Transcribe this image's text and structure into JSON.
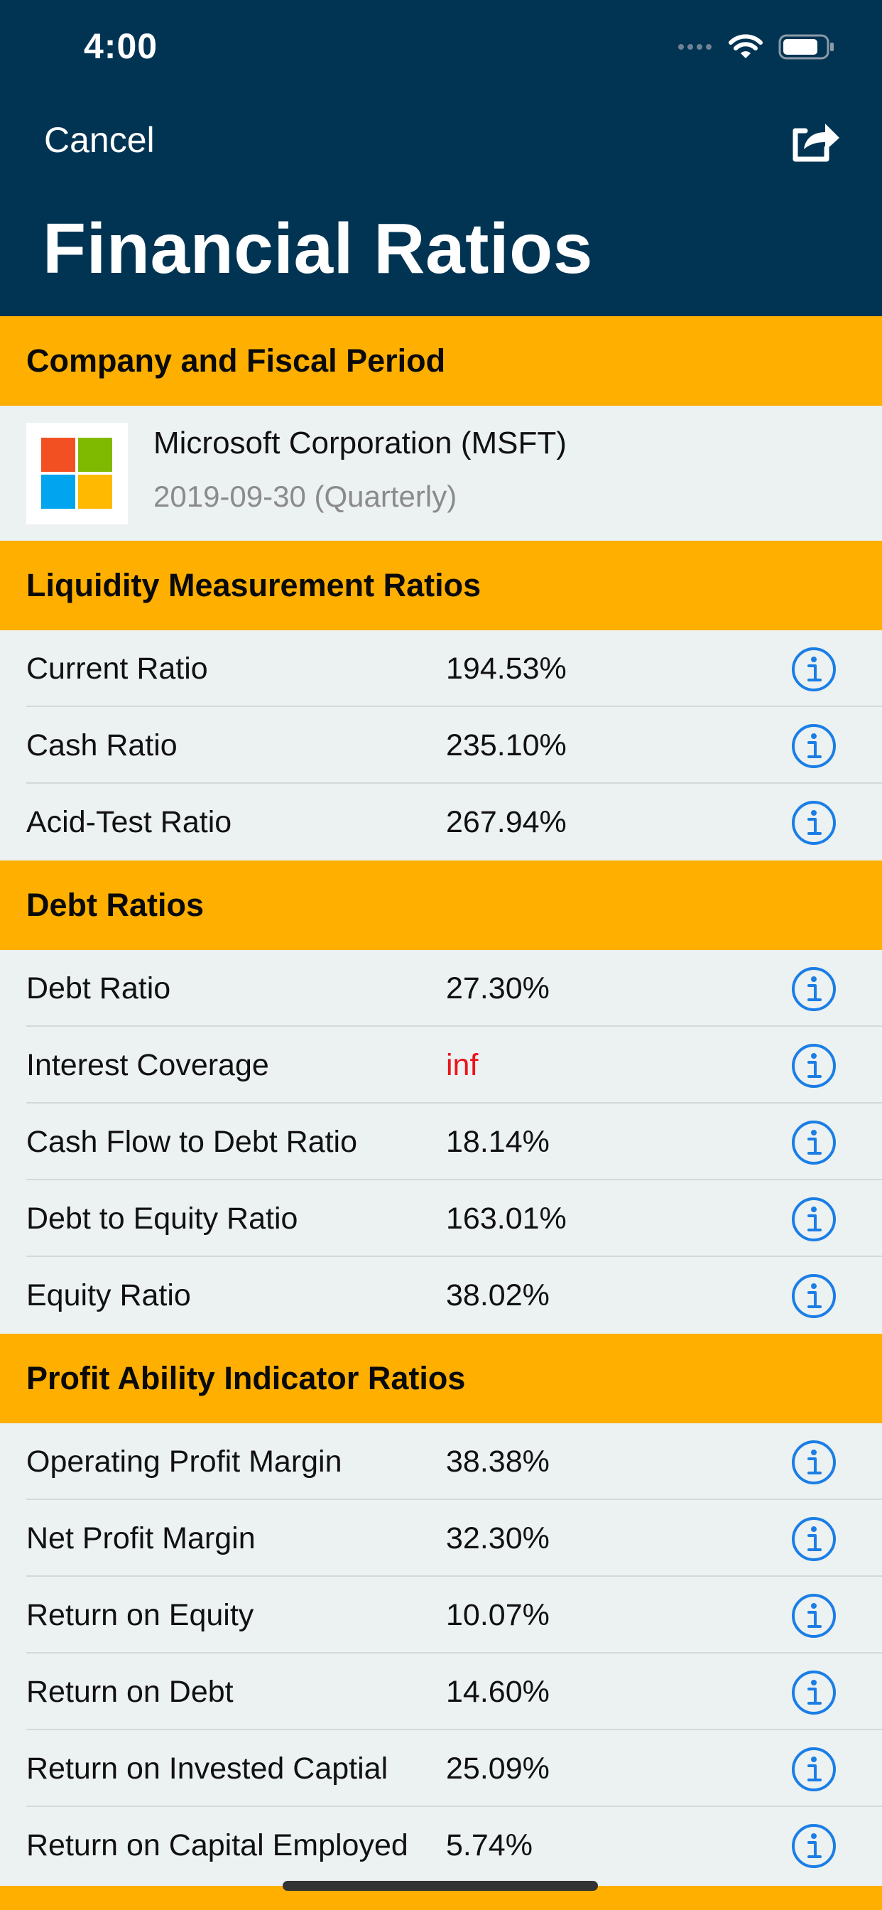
{
  "status_bar": {
    "time": "4:00"
  },
  "nav": {
    "cancel_label": "Cancel",
    "share_icon": "share-icon",
    "title": "Financial Ratios"
  },
  "company_section": {
    "header": "Company and Fiscal Period",
    "company_name": "Microsoft Corporation (MSFT)",
    "period": "2019-09-30 (Quarterly)",
    "logo_colors": [
      "#f25022",
      "#7fba00",
      "#00a4ef",
      "#ffb900"
    ]
  },
  "liquidity": {
    "header": "Liquidity Measurement Ratios",
    "rows": [
      {
        "label": "Current Ratio",
        "value": "194.53%"
      },
      {
        "label": "Cash Ratio",
        "value": "235.10%"
      },
      {
        "label": "Acid-Test Ratio",
        "value": "267.94%"
      }
    ]
  },
  "debt": {
    "header": "Debt Ratios",
    "rows": [
      {
        "label": "Debt Ratio",
        "value": "27.30%"
      },
      {
        "label": "Interest Coverage",
        "value": "inf"
      },
      {
        "label": "Cash Flow to Debt Ratio",
        "value": "18.14%"
      },
      {
        "label": "Debt to Equity Ratio",
        "value": "163.01%"
      },
      {
        "label": "Equity Ratio",
        "value": "38.02%"
      }
    ]
  },
  "profitability": {
    "header": "Profit Ability Indicator Ratios",
    "rows": [
      {
        "label": "Operating Profit Margin",
        "value": "38.38%"
      },
      {
        "label": "Net Profit Margin",
        "value": "32.30%"
      },
      {
        "label": "Return on Equity",
        "value": "10.07%"
      },
      {
        "label": "Return on Debt",
        "value": "14.60%"
      },
      {
        "label": "Return on Invested Captial",
        "value": "25.09%"
      },
      {
        "label": "Return on Capital Employed",
        "value": "5.74%"
      }
    ]
  },
  "colors": {
    "nav_background": "#013453",
    "section_header": "#feaf00",
    "row_background": "#ecf1f1",
    "info_icon": "#1a7ee6",
    "warning_value": "#e8151b"
  }
}
